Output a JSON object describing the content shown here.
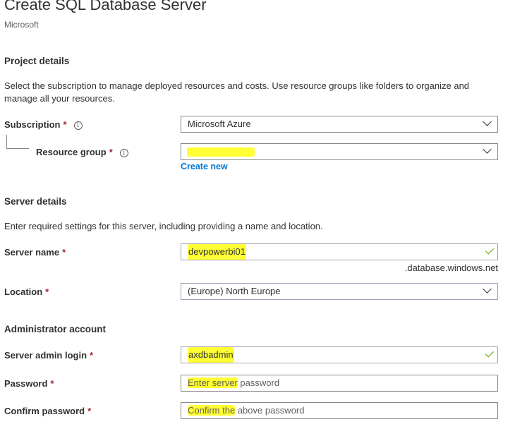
{
  "header": {
    "title": "Create SQL Database Server",
    "publisher": "Microsoft"
  },
  "project": {
    "heading": "Project details",
    "description": "Select the subscription to manage deployed resources and costs. Use resource groups like folders to organize and manage all your resources.",
    "subscription": {
      "label": "Subscription",
      "required": "*",
      "value": "Microsoft Azure"
    },
    "resource_group": {
      "label": "Resource group",
      "required": "*",
      "value": "",
      "create_new": "Create new"
    }
  },
  "server": {
    "heading": "Server details",
    "description": "Enter required settings for this server, including providing a name and location.",
    "name": {
      "label": "Server name",
      "required": "*",
      "value": "devpowerbi01",
      "suffix": ".database.windows.net"
    },
    "location": {
      "label": "Location",
      "required": "*",
      "value": "(Europe) North Europe"
    }
  },
  "admin": {
    "heading": "Administrator account",
    "login": {
      "label": "Server admin login",
      "required": "*",
      "value": "axdbadmin"
    },
    "password": {
      "label": "Password",
      "required": "*",
      "placeholder_hl": "Enter server",
      "placeholder_rest": " password"
    },
    "confirm": {
      "label": "Confirm password",
      "required": "*",
      "placeholder_hl": "Confirm the",
      "placeholder_rest": " above password"
    }
  },
  "colors": {
    "required": "#a4262c",
    "link": "#0078d4",
    "valid_check": "#57a300",
    "highlight": "#ffff33"
  },
  "icons": [
    "info-icon",
    "chevron-down-icon",
    "checkmark-icon"
  ]
}
